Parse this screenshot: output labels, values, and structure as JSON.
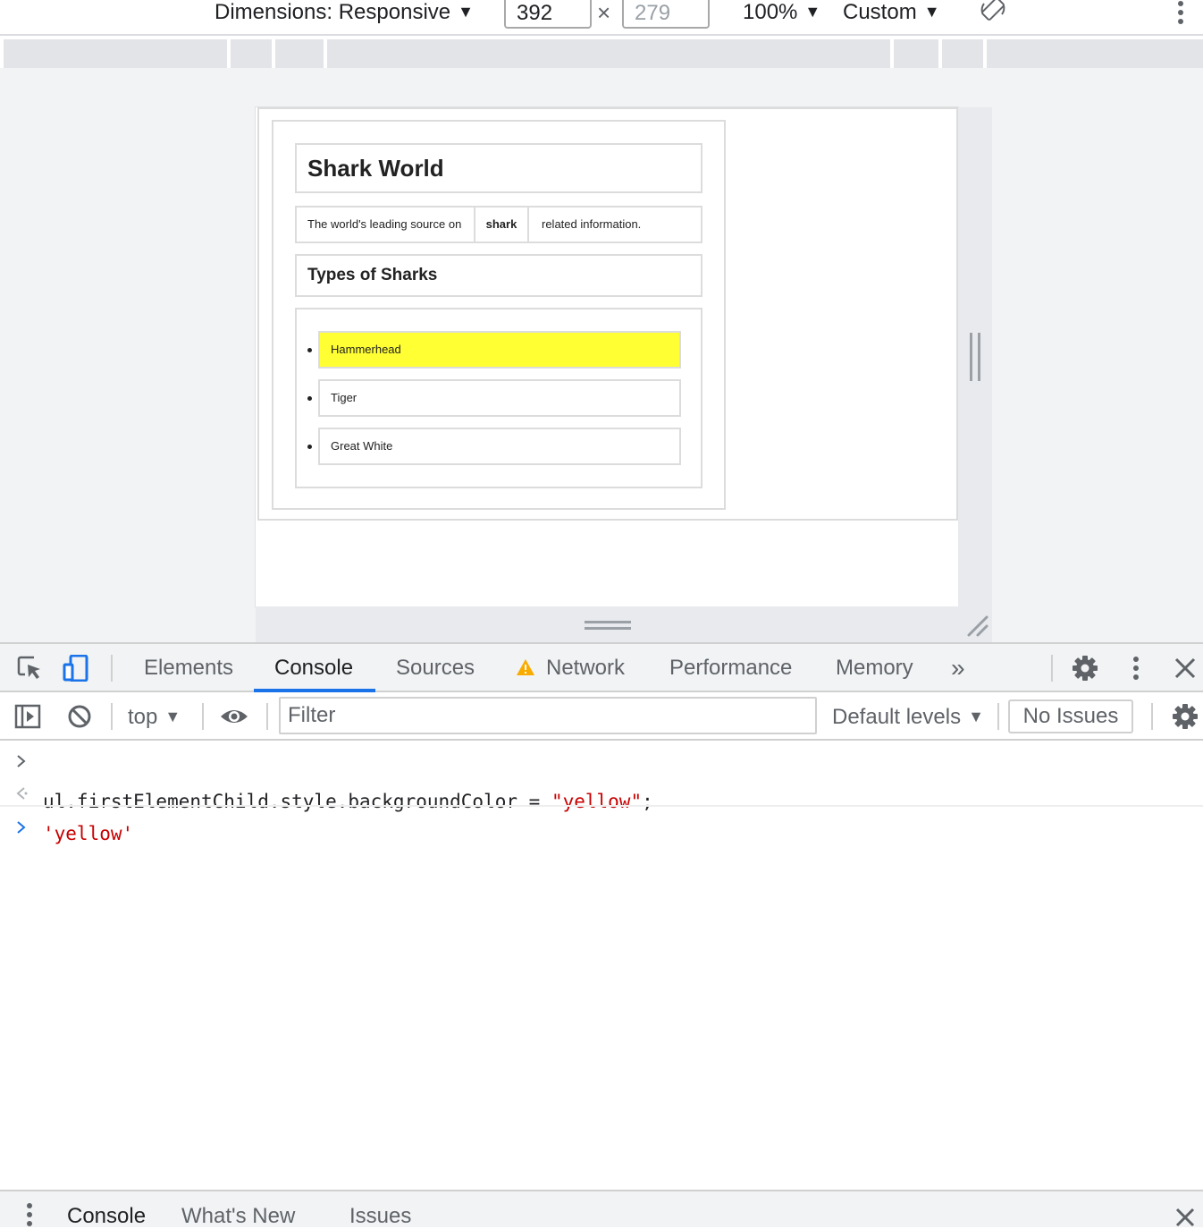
{
  "device_toolbar": {
    "dimensions_label": "Dimensions: Responsive",
    "width_value": "392",
    "height_placeholder": "279",
    "zoom": "100%",
    "throttle": "Custom",
    "times": "×",
    "caret": "▼"
  },
  "page": {
    "h1": "Shark World",
    "paragraph": {
      "before": "The world's leading source on",
      "strong": "shark",
      "after": "related information."
    },
    "h2": "Types of Sharks",
    "list": [
      "Hammerhead",
      "Tiger",
      "Great White"
    ],
    "highlight_color": "#ffff33"
  },
  "devtools": {
    "tabs": [
      "Elements",
      "Console",
      "Sources",
      "Network",
      "Performance",
      "Memory"
    ],
    "active_tab": "Console",
    "more_tabs": "»",
    "accent": "#1a73e8"
  },
  "console_toolbar": {
    "context": "top",
    "filter_placeholder": "Filter",
    "levels": "Default levels",
    "issues": "No Issues"
  },
  "console": {
    "input_code": "ul.firstElementChild.style.backgroundColor = ",
    "input_string": "\"yellow\"",
    "input_end": ";",
    "result": "'yellow'",
    "string_color": "#c80000"
  },
  "drawer": {
    "tabs": [
      "Console",
      "What's New",
      "Issues"
    ],
    "active_tab": "Console"
  }
}
